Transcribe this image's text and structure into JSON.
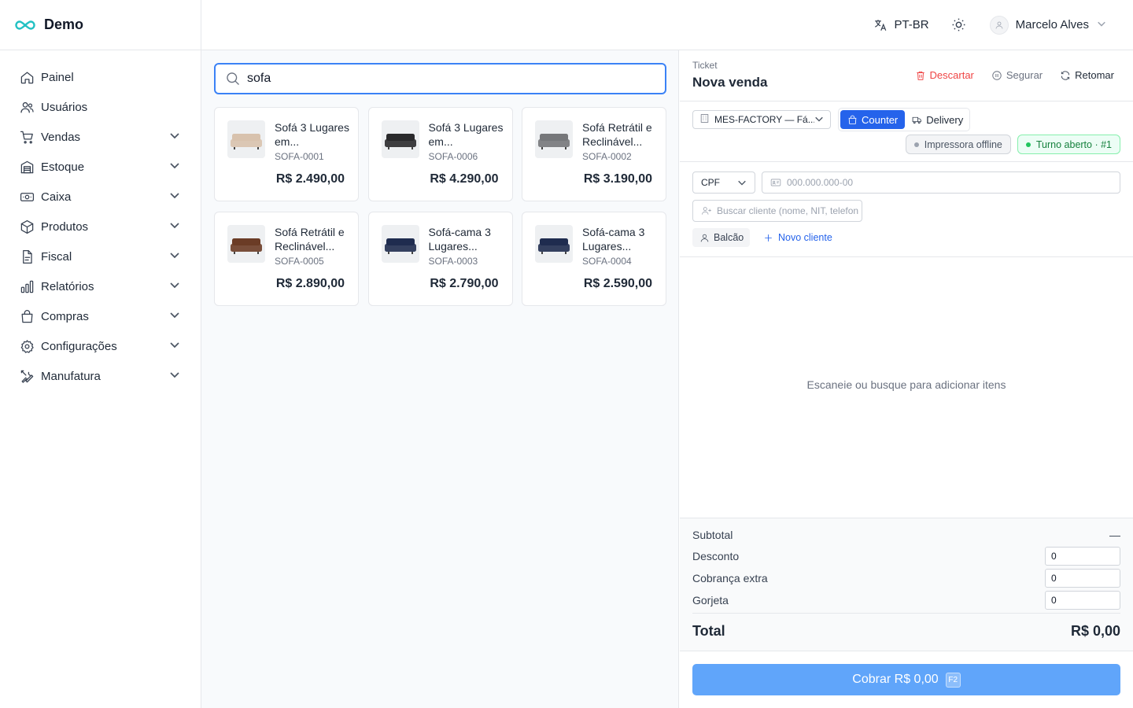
{
  "brand": {
    "name": "Demo",
    "accent": "#22c1c3"
  },
  "sidebar": {
    "items": [
      {
        "label": "Painel",
        "icon": "home-icon",
        "expandable": false
      },
      {
        "label": "Usuários",
        "icon": "users-icon",
        "expandable": false
      },
      {
        "label": "Vendas",
        "icon": "cart-icon",
        "expandable": true
      },
      {
        "label": "Estoque",
        "icon": "warehouse-icon",
        "expandable": true
      },
      {
        "label": "Caixa",
        "icon": "cash-icon",
        "expandable": true
      },
      {
        "label": "Produtos",
        "icon": "box-icon",
        "expandable": true
      },
      {
        "label": "Fiscal",
        "icon": "document-icon",
        "expandable": true
      },
      {
        "label": "Relatórios",
        "icon": "bar-chart-icon",
        "expandable": true
      },
      {
        "label": "Compras",
        "icon": "shopping-bag-icon",
        "expandable": true
      },
      {
        "label": "Configurações",
        "icon": "gear-icon",
        "expandable": true
      },
      {
        "label": "Manufatura",
        "icon": "tools-icon",
        "expandable": true
      }
    ]
  },
  "topbar": {
    "language": "PT-BR",
    "user_name": "Marcelo Alves"
  },
  "search": {
    "value": "sofa",
    "placeholder": ""
  },
  "products": [
    {
      "name": "Sofá 3 Lugares em...",
      "sku": "SOFA-0001",
      "price": "R$ 2.490,00",
      "color": "#d8c2ad"
    },
    {
      "name": "Sofá 3 Lugares em...",
      "sku": "SOFA-0006",
      "price": "R$ 4.290,00",
      "color": "#2a2a2c"
    },
    {
      "name": "Sofá Retrátil e Reclinável...",
      "sku": "SOFA-0002",
      "price": "R$ 3.190,00",
      "color": "#76777a"
    },
    {
      "name": "Sofá Retrátil e Reclinável...",
      "sku": "SOFA-0005",
      "price": "R$ 2.890,00",
      "color": "#6b3c26"
    },
    {
      "name": "Sofá-cama 3 Lugares...",
      "sku": "SOFA-0003",
      "price": "R$ 2.790,00",
      "color": "#1f2c4f"
    },
    {
      "name": "Sofá-cama 3 Lugares...",
      "sku": "SOFA-0004",
      "price": "R$ 2.590,00",
      "color": "#1f2c4f"
    }
  ],
  "ticket": {
    "label": "Ticket",
    "title": "Nova venda",
    "discard": "Descartar",
    "hold": "Segurar",
    "resume": "Retomar",
    "location": "MES-FACTORY — Fá...",
    "mode_counter": "Counter",
    "mode_delivery": "Delivery",
    "printer_status": "Impressora offline",
    "shift_status": "Turno aberto · #1",
    "doc_type": "CPF",
    "doc_placeholder": "000.000.000-00",
    "customer_placeholder": "Buscar cliente (nome, NIT, telefone)",
    "customer_default": "Balcão",
    "new_customer": "Novo cliente",
    "empty_message": "Escaneie ou busque para adicionar itens"
  },
  "totals": {
    "subtotal_label": "Subtotal",
    "subtotal_value": "—",
    "discount_label": "Desconto",
    "discount_value": "0",
    "extra_label": "Cobrança extra",
    "extra_value": "0",
    "tip_label": "Gorjeta",
    "tip_value": "0",
    "total_label": "Total",
    "total_value": "R$ 0,00"
  },
  "charge": {
    "label": "Cobrar R$ 0,00",
    "shortcut": "F2",
    "color": "#60a5fa"
  }
}
